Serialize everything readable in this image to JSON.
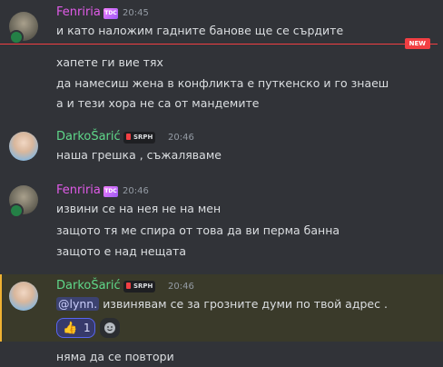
{
  "new_divider": {
    "label": "NEW"
  },
  "messages": [
    {
      "author": "Fenriria",
      "role_badge": "TDC",
      "time": "20:45",
      "lines": [
        "и като наложим гадните банове ще се сърдите"
      ]
    },
    {
      "author": null,
      "lines": [
        "хапете ги вие тях",
        "да намесиш жена в конфликта е путкенско и го знаеш",
        "а и тези хора не са от мандемите"
      ]
    },
    {
      "author": "DarkoŠarić",
      "tag": "SRPH",
      "time": "20:46",
      "lines": [
        "наша грешка , съжаляваме"
      ]
    },
    {
      "author": "Fenriria",
      "role_badge": "TDC",
      "time": "20:46",
      "lines": [
        "извини се на нея не на мен",
        "защото тя ме спира от това да ви перма банна",
        "защото е над нещата"
      ]
    },
    {
      "author": "DarkoŠarić",
      "tag": "SRPH",
      "time": "20:46",
      "mention": "@lynn.",
      "lines": [
        "извинявам се за грозните думи по твой адрес ."
      ],
      "reaction": {
        "emoji": "thumbs-up",
        "glyph": "👍",
        "count": "1"
      }
    },
    {
      "author": null,
      "lines": [
        "няма да се повтори"
      ]
    }
  ],
  "colors": {
    "fenriria": "#e05be8",
    "darko": "#5fd88a",
    "new": "#f23f43",
    "highlight_border": "#f0b232"
  }
}
